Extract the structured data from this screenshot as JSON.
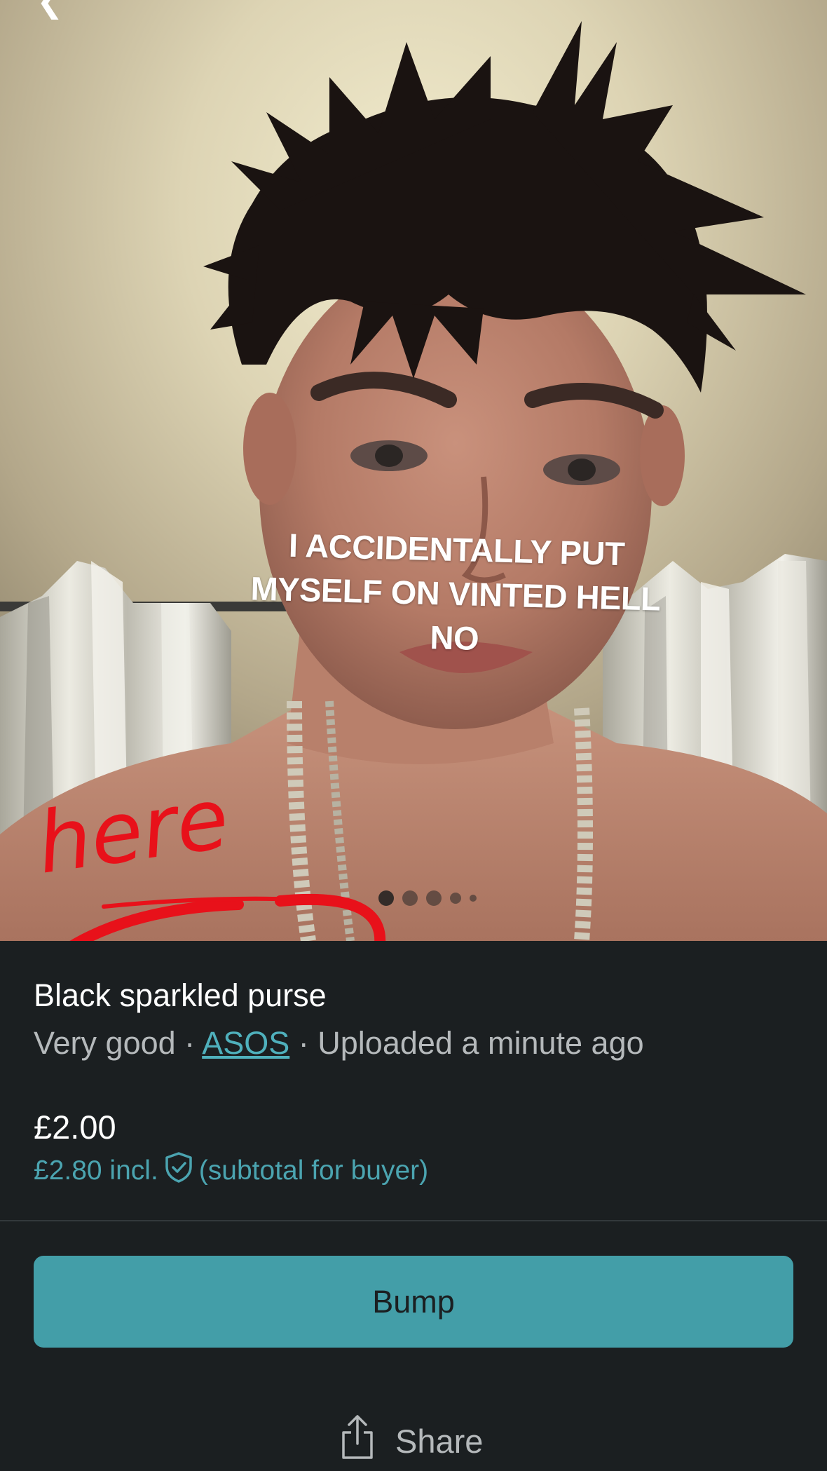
{
  "toolbar": {
    "back_icon": "chevron-left-icon",
    "more_icon": "more-dots-icon"
  },
  "photo": {
    "caption_lines": [
      "I ACCIDENTALLY PUT",
      "MYSELF ON VINTED HELL",
      "NO"
    ],
    "annotation_text": "here",
    "annotation_color": "#e8111a",
    "pager": {
      "count": 5,
      "active_index": 0
    }
  },
  "item": {
    "title": "Black sparkled purse",
    "condition": "Very good",
    "separator": "·",
    "brand": "ASOS",
    "uploaded": "Uploaded a minute ago",
    "price": "£2.00",
    "buyer_price": "£2.80 incl.",
    "buyer_price_note": "(subtotal for buyer)",
    "protection_icon": "shield-check-icon"
  },
  "actions": {
    "bump_label": "Bump",
    "share_label": "Share",
    "share_icon": "share-icon"
  },
  "colors": {
    "background": "#1b1f21",
    "accent": "#439ea8",
    "accent_text": "#4ba4b0",
    "muted_text": "#b5b9bb"
  }
}
